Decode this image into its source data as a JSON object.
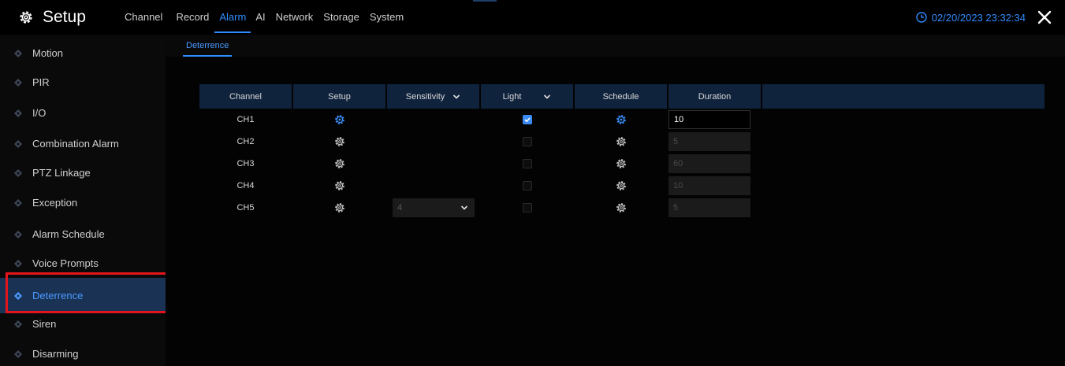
{
  "header": {
    "title": "Setup",
    "datetime": "02/20/2023 23:32:34",
    "nav": [
      "Channel",
      "Record",
      "Alarm",
      "AI",
      "Network",
      "Storage",
      "System"
    ],
    "active_nav": "Alarm"
  },
  "sidebar": {
    "items": [
      {
        "label": "Motion"
      },
      {
        "label": "PIR"
      },
      {
        "label": "I/O"
      },
      {
        "label": "Combination Alarm"
      },
      {
        "label": "PTZ Linkage"
      },
      {
        "label": "Exception"
      },
      {
        "label": "Alarm Schedule"
      },
      {
        "label": "Voice Prompts"
      },
      {
        "label": "Deterrence"
      },
      {
        "label": "Siren"
      },
      {
        "label": "Disarming"
      }
    ],
    "active": "Deterrence"
  },
  "subtab": {
    "label": "Deterrence"
  },
  "table": {
    "headers": {
      "channel": "Channel",
      "setup": "Setup",
      "sensitivity": "Sensitivity",
      "light": "Light",
      "schedule": "Schedule",
      "duration": "Duration"
    },
    "rows": [
      {
        "channel": "CH1",
        "sensitivity": "",
        "light_checked": true,
        "duration": "10"
      },
      {
        "channel": "CH2",
        "sensitivity": "",
        "light_checked": false,
        "duration": "5"
      },
      {
        "channel": "CH3",
        "sensitivity": "",
        "light_checked": false,
        "duration": "60"
      },
      {
        "channel": "CH4",
        "sensitivity": "",
        "light_checked": false,
        "duration": "10"
      },
      {
        "channel": "CH5",
        "sensitivity": "4",
        "light_checked": false,
        "duration": "5"
      }
    ]
  },
  "colors": {
    "accent": "#2f8cff",
    "header_bg": "#10233d",
    "active_side_bg": "#1a3254",
    "highlight": "#e3141b"
  },
  "icons": {
    "logo": "gear-icon",
    "clock": "clock-icon",
    "close": "close-icon",
    "side": "diamond-icon",
    "setup": "gear-icon",
    "dropdown": "chevron-down-icon"
  }
}
